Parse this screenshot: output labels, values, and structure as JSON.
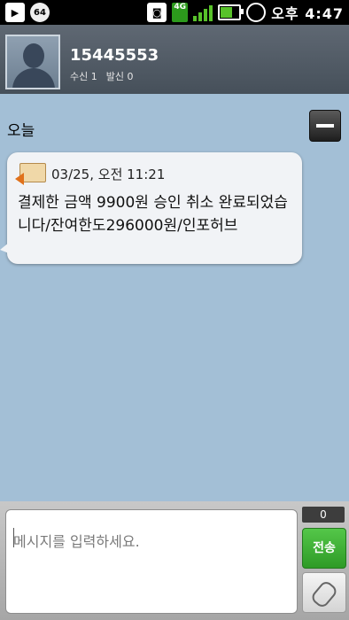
{
  "status_bar": {
    "icons": [
      "media-icon",
      "paw-64-icon",
      "camera-icon",
      "4g-icon",
      "signal-icon",
      "battery-icon",
      "alarm-icon"
    ],
    "badge_64": "64",
    "network": "4G",
    "time": "오후 4:47"
  },
  "contact": {
    "number": "15445553",
    "received_label": "수신 1",
    "sent_label": "발신 0"
  },
  "conversation": {
    "date_separator": "오늘",
    "messages": [
      {
        "timestamp": "03/25, 오전 11:21",
        "body": "결제한 금액 9900원 승인 취소 완료되었습니다/잔여한도296000원/인포허브"
      }
    ]
  },
  "composer": {
    "placeholder": "메시지를 입력하세요.",
    "char_count": "0",
    "send_label": "전송"
  },
  "colors": {
    "background": "#a3bfd6",
    "send_green": "#3ab132"
  }
}
